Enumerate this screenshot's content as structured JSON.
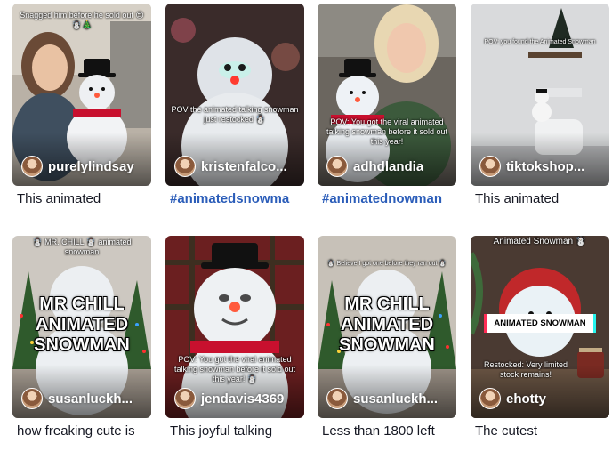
{
  "videos": [
    {
      "username": "purelylindsay",
      "caption": "This animated",
      "caption_is_tag": false,
      "overlay_text": "Snagged him before he sold out 😍☃️🎄",
      "big_text": ""
    },
    {
      "username": "kristenfalco...",
      "caption": "#animatedsnowma",
      "caption_is_tag": true,
      "overlay_text": "POV the animated talking snowman just restocked ☃️",
      "big_text": ""
    },
    {
      "username": "adhdlandia",
      "caption": "#animatednowman",
      "caption_is_tag": true,
      "overlay_text": "POV: You got the viral animated talking snowman before it sold out this year!",
      "big_text": ""
    },
    {
      "username": "tiktokshop...",
      "caption": "This animated",
      "caption_is_tag": false,
      "overlay_text": "POV: you found the Animated Snowman",
      "big_text": ""
    },
    {
      "username": "susanluckh...",
      "caption": "how freaking cute is",
      "caption_is_tag": false,
      "overlay_text": "☃️ MR. CHILL ☃️ animated snowman",
      "big_text": "MR CHILL ANIMATED SNOWMAN"
    },
    {
      "username": "jendavis4369",
      "caption": "This joyful talking",
      "caption_is_tag": false,
      "overlay_text": "POV: You got the viral animated talking snowman before it sold out this year! ☃️",
      "big_text": ""
    },
    {
      "username": "susanluckh...",
      "caption": "Less than 1800 left",
      "caption_is_tag": false,
      "overlay_text": "☃️ Believe I got one before they ran out ☃️",
      "big_text": "MR CHILL ANIMATED SNOWMAN"
    },
    {
      "username": "ehotty",
      "caption": "The cutest",
      "caption_is_tag": false,
      "overlay_text": "Animated Snowman ☃️",
      "badge_text": "ANIMATED SNOWMAN",
      "sub_text": "Restocked: Very limited stock remains!",
      "big_text": ""
    }
  ]
}
